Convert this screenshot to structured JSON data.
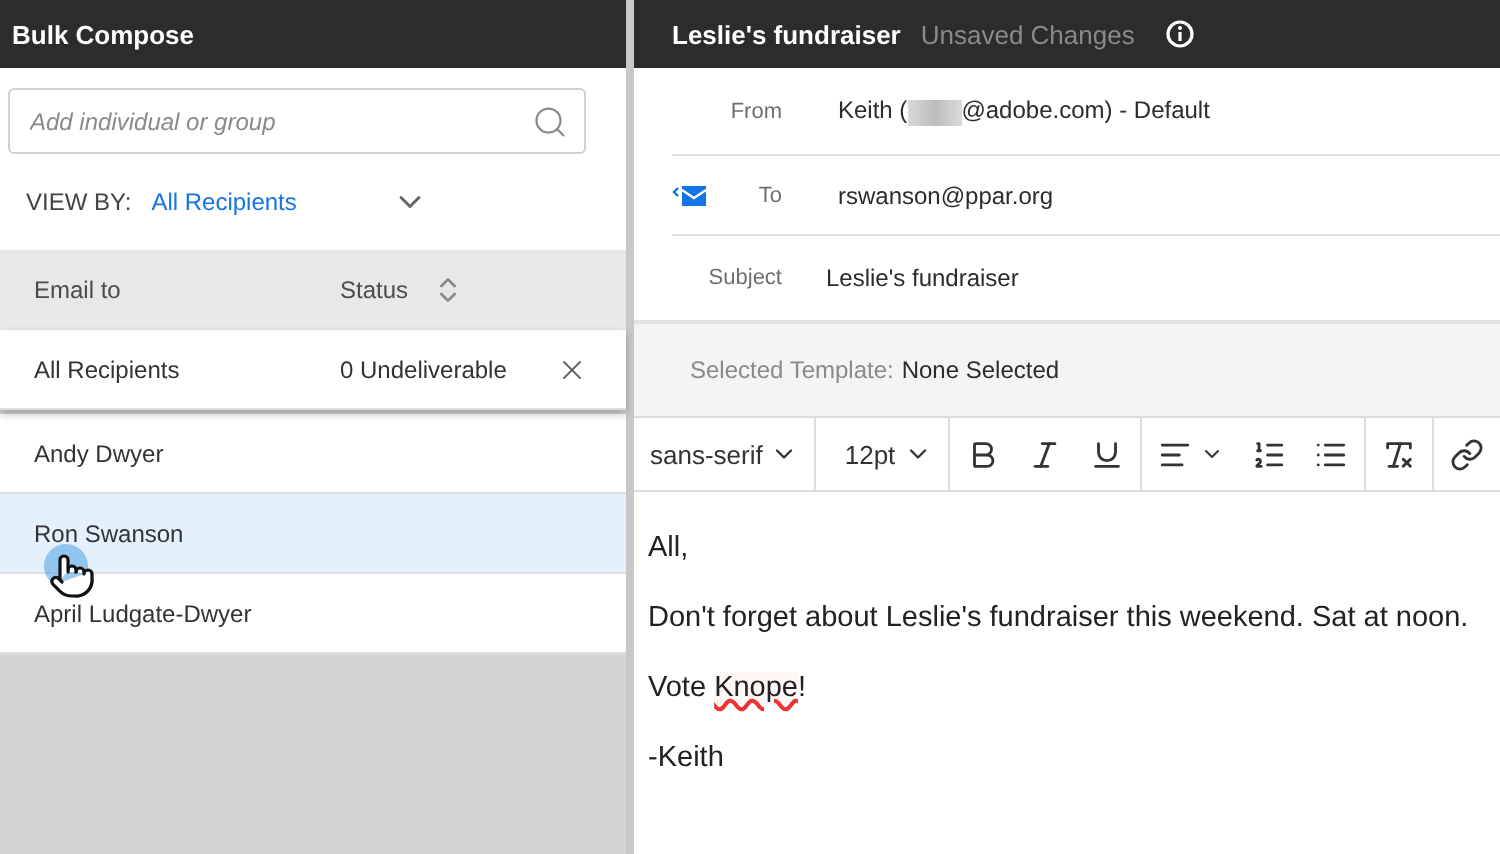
{
  "left_panel": {
    "title": "Bulk Compose",
    "search": {
      "placeholder": "Add individual or group"
    },
    "view_by": {
      "label": "VIEW BY:",
      "value": "All Recipients"
    },
    "table": {
      "columns": [
        "Email to",
        "Status"
      ],
      "summary": {
        "name": "All Recipients",
        "status": "0 Undeliverable"
      },
      "rows": [
        {
          "name": "Andy Dwyer",
          "selected": false
        },
        {
          "name": "Ron Swanson",
          "selected": true
        },
        {
          "name": "April Ludgate-Dwyer",
          "selected": false
        }
      ]
    }
  },
  "editor": {
    "title": "Leslie's fundraiser",
    "status": "Unsaved Changes",
    "from": {
      "label": "From",
      "before": "Keith (",
      "after": "@adobe.com) - Default"
    },
    "to": {
      "label": "To",
      "value": "rswanson@ppar.org"
    },
    "subject": {
      "label": "Subject",
      "value": "Leslie's fundraiser"
    },
    "template": {
      "label": "Selected Template:",
      "value": "None Selected"
    },
    "toolbar": {
      "font": "sans-serif",
      "size": "12pt"
    },
    "body": [
      [
        {
          "text": "All,",
          "misspelled": false
        }
      ],
      [
        {
          "text": "Don't forget about Leslie's fundraiser this weekend. Sat at noon.",
          "misspelled": false
        }
      ],
      [
        {
          "text": "Vote ",
          "misspelled": false
        },
        {
          "text": "Knope",
          "misspelled": true
        },
        {
          "text": "!",
          "misspelled": false
        }
      ],
      [
        {
          "text": "-Keith",
          "misspelled": false
        }
      ]
    ]
  }
}
